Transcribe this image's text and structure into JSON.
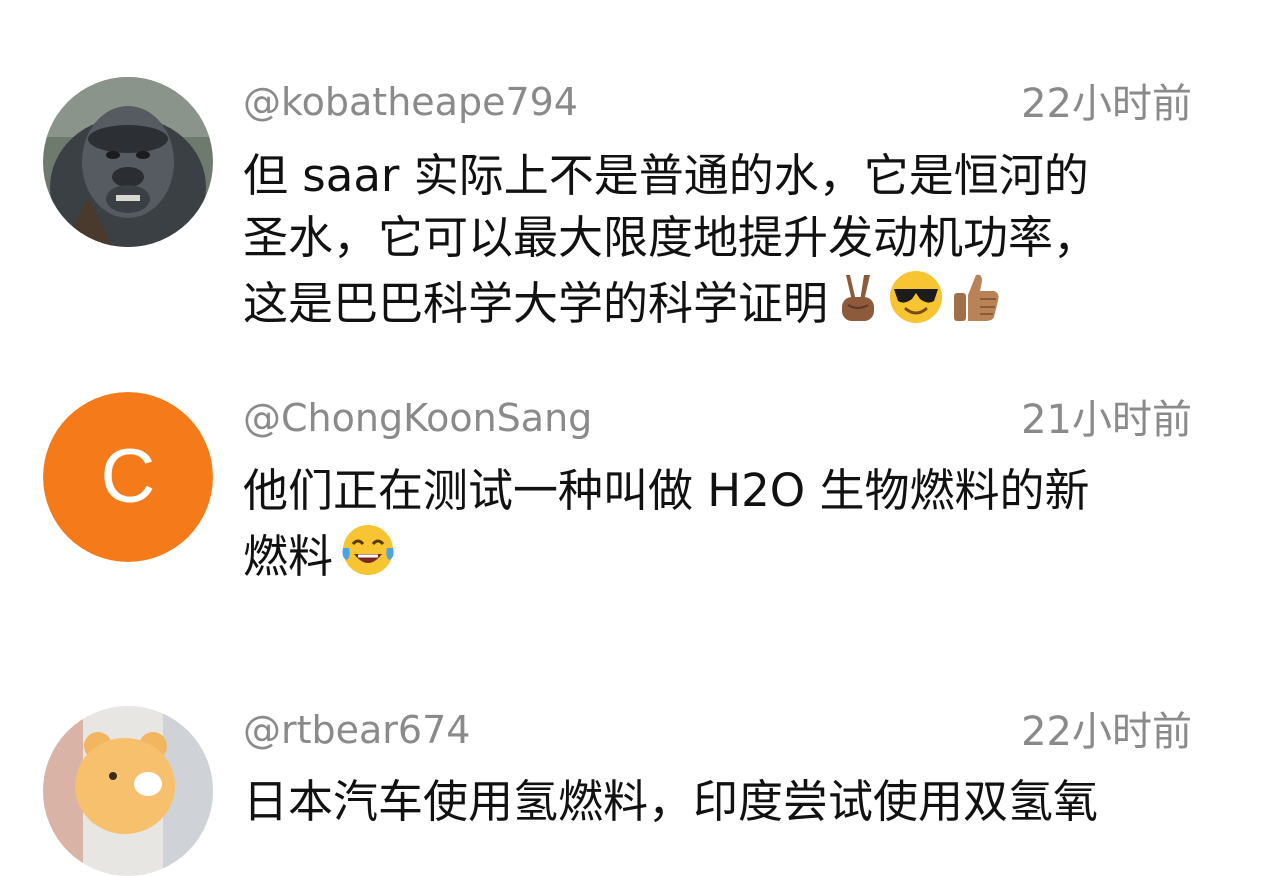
{
  "comments": [
    {
      "username": "@kobatheape794",
      "time": "22小时前",
      "lines": [
        "但 saar 实际上不是普通的水，它是恒河的",
        "圣水，它可以最大限度地提升发动机功率，",
        "这是巴巴科学大学的科学证明"
      ],
      "avatar": "ape-photo",
      "emojis": [
        "victory-hand-emoji",
        "sunglasses-face-emoji",
        "thumbs-up-emoji"
      ]
    },
    {
      "username": "@ChongKoonSang",
      "time": "21小时前",
      "lines": [
        "他们正在测试一种叫做 H2O 生物燃料的新",
        "燃料"
      ],
      "avatar_letter": "C",
      "avatar_color": "#F57A1A",
      "emojis": [
        "tears-of-joy-emoji"
      ]
    },
    {
      "username": "@rtbear674",
      "time": "22小时前",
      "lines": [
        "日本汽车使用氢燃料，印度尝试使用双氢氧"
      ],
      "avatar": "bear-cartoon"
    }
  ]
}
